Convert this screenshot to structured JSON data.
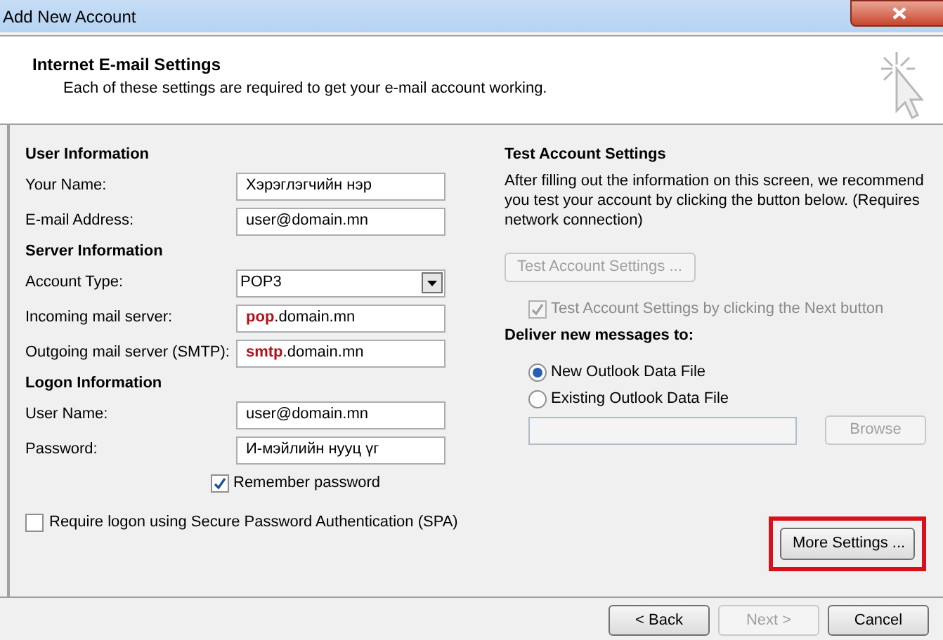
{
  "window": {
    "title": "Add New Account"
  },
  "header": {
    "title": "Internet E-mail Settings",
    "subtitle": "Each of these settings are required to get your e-mail account working."
  },
  "left_groups": [
    {
      "heading": "User Information",
      "fields": [
        {
          "kind": "text",
          "label": "Your Name:",
          "value": "Хэрэглэгчийн нэр"
        },
        {
          "kind": "text",
          "label": "E-mail Address:",
          "value": "user@domain.mn"
        }
      ]
    },
    {
      "heading": "Server Information",
      "fields": [
        {
          "kind": "select",
          "label": "Account Type:",
          "value": "POP3"
        },
        {
          "kind": "text",
          "label": "Incoming mail server:",
          "value": "**pop**.domain.mn"
        },
        {
          "kind": "text",
          "label": "Outgoing mail server (SMTP):",
          "value": "**smtp**.domain.mn"
        }
      ]
    },
    {
      "heading": "Logon Information",
      "fields": [
        {
          "kind": "text",
          "label": "User Name:",
          "value": "user@domain.mn"
        },
        {
          "kind": "text",
          "label": "Password:",
          "value": "И-мэйлийн нууц үг"
        }
      ]
    }
  ],
  "remember_password": {
    "label": "Remember password",
    "checked": true
  },
  "spa": {
    "label": "Require logon using Secure Password Authentication (SPA)",
    "checked": false
  },
  "test": {
    "heading": "Test Account Settings",
    "description": "After filling out the information on this screen, we recommend you test your account by clicking the button below. (Requires network connection)",
    "button": {
      "label": "Test Account Settings ...",
      "disabled": true
    },
    "auto_test": {
      "label": "Test Account Settings by clicking the Next button",
      "checked": true,
      "disabled": true
    }
  },
  "deliver": {
    "heading": "Deliver new messages to:",
    "options": [
      {
        "label": "New Outlook Data File",
        "selected": true
      },
      {
        "label": "Existing Outlook Data File",
        "selected": false
      }
    ],
    "browse": {
      "label": "Browse",
      "disabled": true
    }
  },
  "more_settings": {
    "label": "More Settings ...",
    "highlighted": true
  },
  "buttons": [
    {
      "label": "< Back",
      "disabled": false
    },
    {
      "label": "Next >",
      "disabled": true
    },
    {
      "label": "Cancel",
      "disabled": false
    }
  ]
}
